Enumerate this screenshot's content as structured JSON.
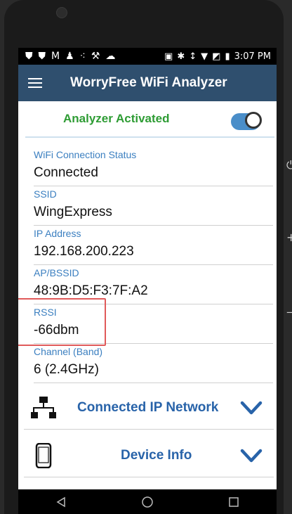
{
  "status_bar": {
    "time": "3:07 PM",
    "icons": [
      "shield-icon",
      "shield-icon",
      "gmail-icon",
      "person-icon",
      "dots-icon",
      "wrench-icon",
      "cloud-icon",
      "cast-icon",
      "bluetooth-icon",
      "vibrate-icon",
      "wifi-icon",
      "no-signal-icon",
      "battery-icon"
    ]
  },
  "app_bar": {
    "title": "WorryFree WiFi Analyzer"
  },
  "activation": {
    "label": "Analyzer Activated",
    "toggle_on": true
  },
  "fields": [
    {
      "label": "WiFi Connection Status",
      "value": "Connected"
    },
    {
      "label": "SSID",
      "value": "WingExpress"
    },
    {
      "label": "IP Address",
      "value": "192.168.200.223"
    },
    {
      "label": "AP/BSSID",
      "value": "48:9B:D5:F3:7F:A2"
    },
    {
      "label": "RSSI",
      "value": "-66dbm"
    },
    {
      "label": "Channel (Band)",
      "value": "6 (2.4GHz)"
    }
  ],
  "sections": [
    {
      "label": "Connected IP Network",
      "icon": "network-icon"
    },
    {
      "label": "Device Info",
      "icon": "phone-icon"
    }
  ],
  "colors": {
    "app_bar": "#2f4f6e",
    "activated_green": "#2e9c34",
    "label_blue": "#3b7fc0",
    "section_blue": "#2863a9",
    "highlight_red": "#e05a5a"
  }
}
